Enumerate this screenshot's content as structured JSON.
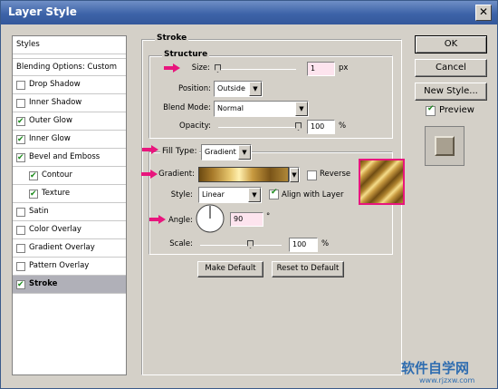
{
  "window": {
    "title": "Layer Style",
    "close_glyph": "✕"
  },
  "styles_list": {
    "header": "Styles",
    "blending": "Blending Options: Custom",
    "items": [
      {
        "label": "Drop Shadow",
        "checked": false,
        "indent": false
      },
      {
        "label": "Inner Shadow",
        "checked": false,
        "indent": false
      },
      {
        "label": "Outer Glow",
        "checked": true,
        "indent": false
      },
      {
        "label": "Inner Glow",
        "checked": true,
        "indent": false
      },
      {
        "label": "Bevel and Emboss",
        "checked": true,
        "indent": false
      },
      {
        "label": "Contour",
        "checked": true,
        "indent": true
      },
      {
        "label": "Texture",
        "checked": true,
        "indent": true
      },
      {
        "label": "Satin",
        "checked": false,
        "indent": false
      },
      {
        "label": "Color Overlay",
        "checked": false,
        "indent": false
      },
      {
        "label": "Gradient Overlay",
        "checked": false,
        "indent": false
      },
      {
        "label": "Pattern Overlay",
        "checked": false,
        "indent": false
      },
      {
        "label": "Stroke",
        "checked": true,
        "indent": false,
        "selected": true
      }
    ]
  },
  "stroke": {
    "group_title": "Stroke",
    "structure_title": "Structure",
    "size_label": "Size:",
    "size_value": "1",
    "size_unit": "px",
    "size_level": 0.02,
    "position_label": "Position:",
    "position_value": "Outside",
    "blend_label": "Blend Mode:",
    "blend_value": "Normal",
    "opacity_label": "Opacity:",
    "opacity_value": "100",
    "opacity_unit": "%",
    "opacity_level": 1.0,
    "fill_type_label": "Fill Type:",
    "fill_type_value": "Gradient",
    "gradient_label": "Gradient:",
    "reverse_label": "Reverse",
    "reverse_checked": false,
    "style_label": "Style:",
    "style_value": "Linear",
    "align_label": "Align with Layer",
    "align_checked": true,
    "angle_label": "Angle:",
    "angle_value": "90",
    "angle_unit": "°",
    "scale_label": "Scale:",
    "scale_value": "100",
    "scale_unit": "%",
    "scale_level": 0.5
  },
  "buttons": {
    "make_default": "Make Default",
    "reset_default": "Reset to Default",
    "ok": "OK",
    "cancel": "Cancel",
    "new_style": "New Style...",
    "preview": "Preview",
    "preview_checked": true
  },
  "watermark": {
    "text": "软件自学网",
    "url": "www.rjzxw.com"
  },
  "colors": {
    "accent_arrow": "#e8157d",
    "gold_dark": "#6b4a12",
    "gold_light": "#f5dc8a"
  }
}
